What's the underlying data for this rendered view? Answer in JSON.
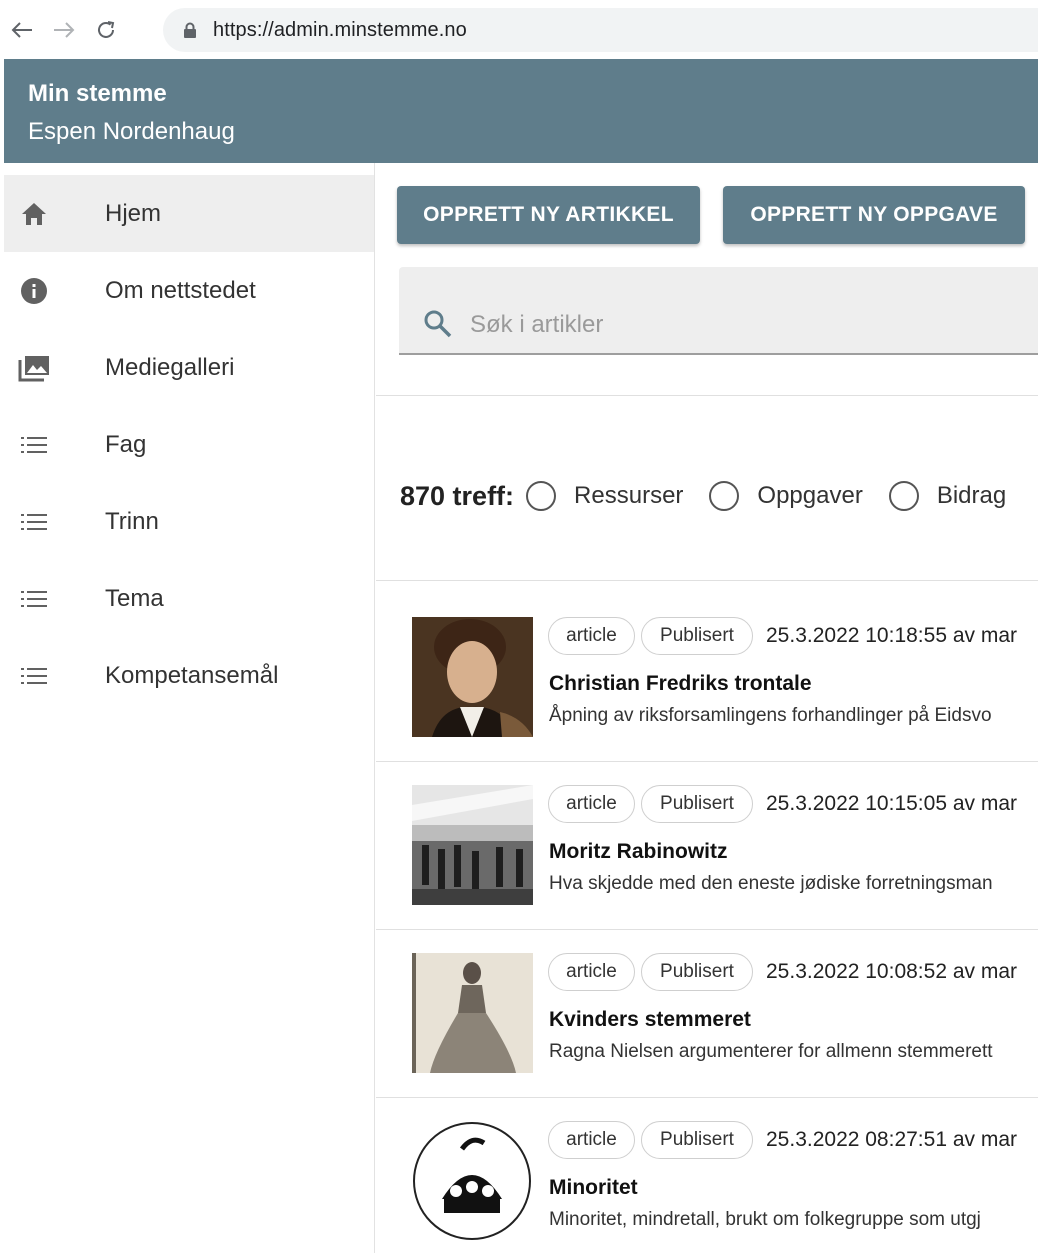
{
  "browser": {
    "url": "https://admin.minstemme.no"
  },
  "app": {
    "title": "Min stemme",
    "user": "Espen Nordenhaug",
    "colors": {
      "primary": "#5f7d8b",
      "sidebar_active": "#eeeeee"
    }
  },
  "sidebar": {
    "items": [
      {
        "label": "Hjem",
        "icon": "home-icon",
        "active": true
      },
      {
        "label": "Om nettstedet",
        "icon": "info-icon",
        "active": false
      },
      {
        "label": "Mediegalleri",
        "icon": "photo-library-icon",
        "active": false
      },
      {
        "label": "Fag",
        "icon": "list-icon",
        "active": false
      },
      {
        "label": "Trinn",
        "icon": "list-icon",
        "active": false
      },
      {
        "label": "Tema",
        "icon": "list-icon",
        "active": false
      },
      {
        "label": "Kompetansemål",
        "icon": "list-icon",
        "active": false
      }
    ]
  },
  "toolbar": {
    "new_article": "OPPRETT NY ARTIKKEL",
    "new_task": "OPPRETT NY OPPGAVE"
  },
  "search": {
    "placeholder": "Søk i artikler"
  },
  "filters": {
    "hits": "870 treff:",
    "options": [
      "Ressurser",
      "Oppgaver",
      "Bidrag"
    ]
  },
  "articles": [
    {
      "type": "article",
      "status": "Publisert",
      "meta": "25.3.2022 10:18:55 av mar",
      "title": "Christian Fredriks trontale",
      "description": "Åpning av riksforsamlingens forhandlinger på Eidsvo"
    },
    {
      "type": "article",
      "status": "Publisert",
      "meta": "25.3.2022 10:15:05 av mar",
      "title": "Moritz Rabinowitz",
      "description": "Hva skjedde med den eneste jødiske forretningsman"
    },
    {
      "type": "article",
      "status": "Publisert",
      "meta": "25.3.2022 10:08:52 av mar",
      "title": "Kvinders stemmeret",
      "description": "Ragna Nielsen argumenterer for allmenn stemmerett"
    },
    {
      "type": "article",
      "status": "Publisert",
      "meta": "25.3.2022 08:27:51 av mar",
      "title": "Minoritet",
      "description": "Minoritet, mindretall, brukt om folkegruppe som utgj"
    }
  ]
}
